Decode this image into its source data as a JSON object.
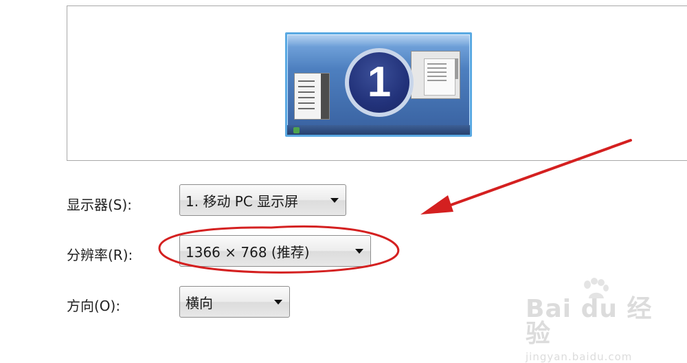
{
  "monitor_preview": {
    "monitor_number": "1"
  },
  "settings": {
    "display": {
      "label": "显示器(S):",
      "value": "1. 移动 PC 显示屏"
    },
    "resolution": {
      "label": "分辨率(R):",
      "value": "1366 × 768 (推荐)"
    },
    "orientation": {
      "label": "方向(O):",
      "value": "横向"
    }
  },
  "annotations": {
    "highlight_color": "#d42020"
  },
  "watermark": {
    "brand": "Bai du 经验",
    "url": "jingyan.baidu.com"
  }
}
